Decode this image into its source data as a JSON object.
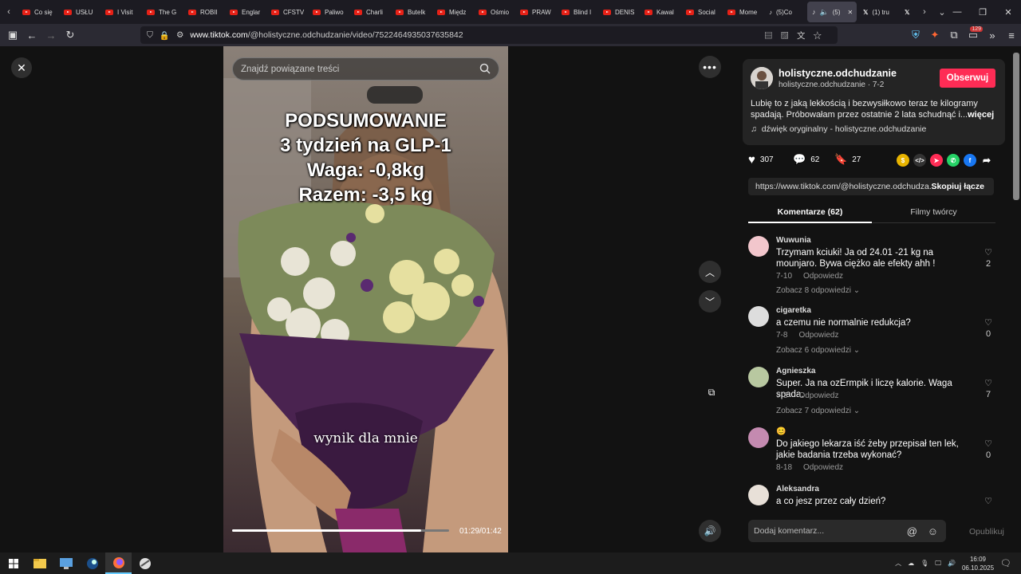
{
  "browser": {
    "tabs": [
      {
        "label": "Co się"
      },
      {
        "label": "USŁU"
      },
      {
        "label": "I Visit"
      },
      {
        "label": "The G"
      },
      {
        "label": "ROBII"
      },
      {
        "label": "Englar"
      },
      {
        "label": "CFSTV"
      },
      {
        "label": "Paliwo"
      },
      {
        "label": "Charli"
      },
      {
        "label": "Butelk"
      },
      {
        "label": "Międz"
      },
      {
        "label": "Ośmio"
      },
      {
        "label": "PRAW"
      },
      {
        "label": "Blind I"
      },
      {
        "label": "DENIS"
      },
      {
        "label": "Kawal"
      },
      {
        "label": "Social"
      },
      {
        "label": "Mome"
      },
      {
        "label": "(5)Co"
      }
    ],
    "active_tab": "(5)",
    "tab_after_active_1": "(1) tru",
    "url_host": "www.tiktok.com",
    "url_path": "/@holistyczne.odchudzanie/video/7522464935037635842",
    "pocket_badge": "129"
  },
  "video": {
    "search_placeholder": "Znajdź powiązane treści",
    "overlay_lines": [
      "PODSUMOWANIE",
      "3 tydzień na GLP-1",
      "Waga: -0,8kg",
      "Razem: -3,5 kg"
    ],
    "caption": "wynik dla mnie",
    "time": "01:29/01:42",
    "progress": 0.87
  },
  "author": {
    "name": "holistyczne.odchudzanie",
    "sub": "holistyczne.odchudzanie · 7-2",
    "follow_label": "Obserwuj",
    "description": "Lubię to z jaką lekkością i bezwysiłkowo teraz te kilogramy spadają. Próbowałam przez ostatnie 2 lata schudnąć i...",
    "more_label": "więcej",
    "music": "dźwięk oryginalny - holistyczne.odchudzanie"
  },
  "stats": {
    "likes": "307",
    "comments": "62",
    "saves": "27"
  },
  "link": {
    "url": "https://www.tiktok.com/@holistyczne.odchudza...",
    "copy_label": "Skopiuj łącze"
  },
  "tabs": {
    "comments": "Komentarze (62)",
    "creator": "Filmy twórcy"
  },
  "comments": [
    {
      "user": "Wuwunia",
      "text": "Trzymam kciuki! Ja od 24.01 -21 kg na mounjaro. Bywa ciężko ale efekty ahh !",
      "date": "7-10",
      "reply": "Odpowiedz",
      "more": "Zobacz 8 odpowiedzi",
      "likes": "2"
    },
    {
      "user": "cigaretka",
      "text": "a czemu nie normalnie redukcja?",
      "date": "7-8",
      "reply": "Odpowiedz",
      "more": "Zobacz 6 odpowiedzi",
      "likes": "0"
    },
    {
      "user": "Agnieszka",
      "text": "Super. Ja na ozErmpik i liczę kalorie. Waga spada.",
      "date": "7-3",
      "reply": "Odpowiedz",
      "more": "Zobacz 7 odpowiedzi",
      "likes": "7"
    },
    {
      "user": "😊",
      "text": "Do jakiego lekarza iść żeby przepisał ten lek, jakie badania trzeba wykonać?",
      "date": "8-18",
      "reply": "Odpowiedz",
      "more": "",
      "likes": "0"
    },
    {
      "user": "Aleksandra",
      "text": "a co jesz przez cały dzień?",
      "date": "",
      "reply": "",
      "more": "",
      "likes": ""
    }
  ],
  "composer": {
    "placeholder": "Dodaj komentarz...",
    "publish": "Opublikuj"
  },
  "taskbar": {
    "time": "16:09",
    "date": "06.10.2025"
  }
}
